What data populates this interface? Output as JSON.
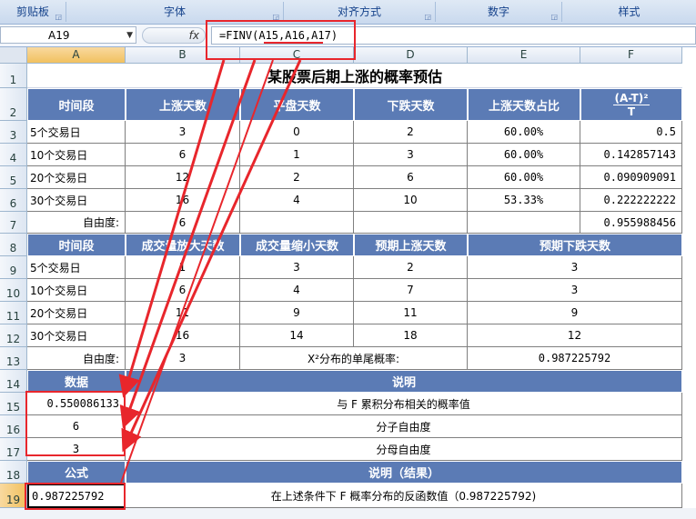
{
  "ribbon": {
    "groups": [
      "剪贴板",
      "字体",
      "对齐方式",
      "数字",
      "样式"
    ]
  },
  "formula_bar": {
    "name_box": "A19",
    "fx": "fx",
    "formula": "=FINV(A15,A16,A17)"
  },
  "columns": [
    "A",
    "B",
    "C",
    "D",
    "E",
    "F"
  ],
  "rows": [
    "1",
    "2",
    "3",
    "4",
    "5",
    "6",
    "7",
    "8",
    "9",
    "10",
    "11",
    "12",
    "13",
    "14",
    "15",
    "16",
    "17",
    "18",
    "19"
  ],
  "sheet": {
    "title": "某股票后期上涨的概率预估",
    "table1": {
      "headers": [
        "时间段",
        "上涨天数",
        "平盘天数",
        "下跌天数",
        "上涨天数占比"
      ],
      "formula_header_num": "(A-T)²",
      "formula_header_den": "T",
      "rows": [
        [
          "5个交易日",
          "3",
          "0",
          "2",
          "60.00%",
          "0.5"
        ],
        [
          "10个交易日",
          "6",
          "1",
          "3",
          "60.00%",
          "0.142857143"
        ],
        [
          "20个交易日",
          "12",
          "2",
          "6",
          "60.00%",
          "0.090909091"
        ],
        [
          "30个交易日",
          "16",
          "4",
          "10",
          "53.33%",
          "0.222222222"
        ]
      ],
      "dof_label": "自由度:",
      "dof_value": "6",
      "chi_sum": "0.955988456"
    },
    "table2": {
      "headers": [
        "时间段",
        "成交量放大天数",
        "成交量缩小天数",
        "预期上涨天数",
        "预期下跌天数"
      ],
      "rows": [
        [
          "5个交易日",
          "1",
          "3",
          "2",
          "3"
        ],
        [
          "10个交易日",
          "6",
          "4",
          "7",
          "3"
        ],
        [
          "20个交易日",
          "11",
          "9",
          "11",
          "9"
        ],
        [
          "30个交易日",
          "16",
          "14",
          "18",
          "12"
        ]
      ],
      "dof_label": "自由度:",
      "dof_value": "3",
      "prob_label": "X²分布的单尾概率:",
      "prob_value": "0.987225792"
    },
    "table3": {
      "header_data": "数据",
      "header_desc": "说明",
      "rows": [
        [
          "0.550086133",
          "与 F 累积分布相关的概率值"
        ],
        [
          "6",
          "分子自由度"
        ],
        [
          "3",
          "分母自由度"
        ]
      ],
      "header_formula": "公式",
      "header_result": "说明（结果）",
      "result_value": "0.987225792",
      "result_desc": "在上述条件下 F 概率分布的反函数值（0.987225792)"
    }
  },
  "colors": {
    "header_fill": "#5b7bb5",
    "annotation": "#e8262c"
  }
}
